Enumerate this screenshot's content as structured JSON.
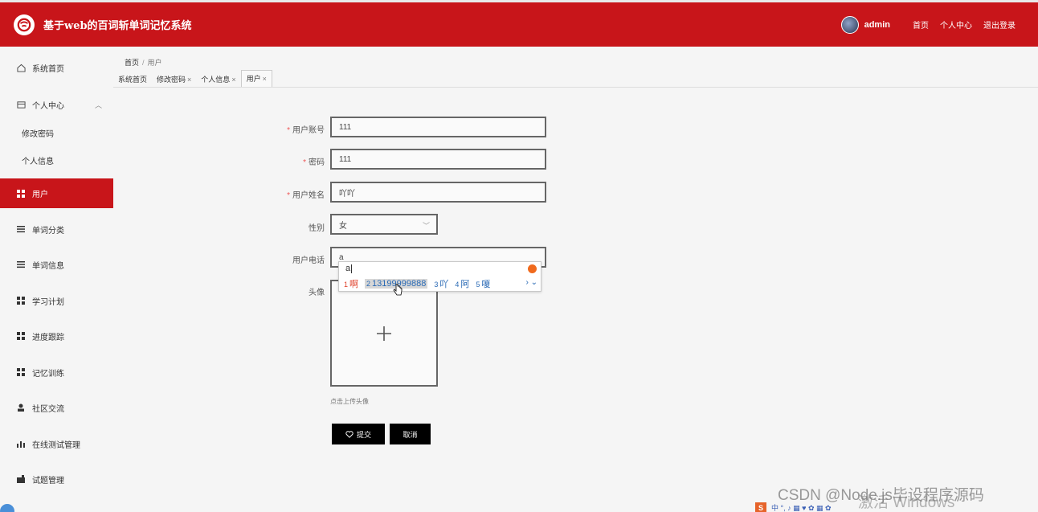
{
  "header": {
    "title": "基于web的百词斩单词记忆系统",
    "user": "admin",
    "links": [
      "首页",
      "个人中心",
      "退出登录"
    ],
    "accent": "#c8151a"
  },
  "sidebar": {
    "home": "系统首页",
    "personal": "个人中心",
    "sub": [
      "修改密码",
      "个人信息"
    ],
    "items": [
      "用户",
      "单词分类",
      "单词信息",
      "学习计划",
      "进度跟踪",
      "记忆训练",
      "社区交流",
      "在线测试管理",
      "试题管理"
    ]
  },
  "breadcrumb": {
    "home": "首页",
    "sep": "/",
    "current": "用户"
  },
  "tabs": [
    {
      "label": "系统首页",
      "close": ""
    },
    {
      "label": "修改密码",
      "close": "×"
    },
    {
      "label": "个人信息",
      "close": "×"
    },
    {
      "label": "用户",
      "close": "×"
    }
  ],
  "form": {
    "account": {
      "label": "用户账号",
      "value": "111"
    },
    "password": {
      "label": "密码",
      "value": "111"
    },
    "name": {
      "label": "用户姓名",
      "value": "吖吖"
    },
    "gender": {
      "label": "性别",
      "value": "女"
    },
    "phone": {
      "label": "用户电话",
      "value": "a"
    },
    "avatar": {
      "label": "头像",
      "hint": "点击上传头像"
    },
    "required_mark": "*"
  },
  "buttons": {
    "submit": "提交",
    "cancel": "取消"
  },
  "ime": {
    "composition": "a",
    "candidates": [
      {
        "n": "1",
        "text": "啊"
      },
      {
        "n": "2",
        "text": "13199999888"
      },
      {
        "n": "3",
        "text": "吖"
      },
      {
        "n": "4",
        "text": "阿"
      },
      {
        "n": "5",
        "text": "嗄"
      }
    ],
    "nav": "› ⌄"
  },
  "watermarks": {
    "csdn": "CSDN @Node.js毕设程序源码",
    "windows": "激活 Windows",
    "tray": "中 °, ♪ ▦ ♥ ✿ ▦ ✿"
  }
}
